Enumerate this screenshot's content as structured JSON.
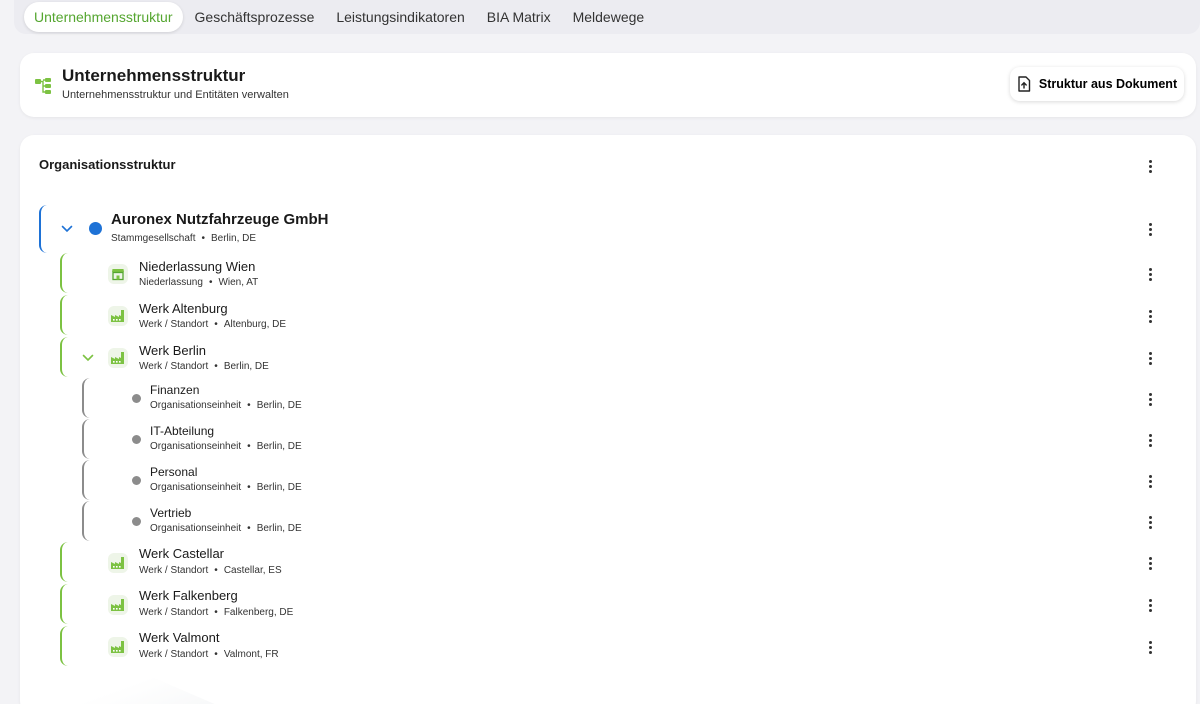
{
  "tabs": [
    {
      "label": "Unternehmensstruktur",
      "active": true
    },
    {
      "label": "Geschäftsprozesse",
      "active": false
    },
    {
      "label": "Leistungsindikatoren",
      "active": false
    },
    {
      "label": "BIA Matrix",
      "active": false
    },
    {
      "label": "Meldewege",
      "active": false
    }
  ],
  "header": {
    "icon": "hierarchy-icon",
    "title": "Unternehmensstruktur",
    "subtitle": "Unternehmensstruktur und Entitäten verwalten",
    "button_label": "Struktur aus Dokument",
    "button_icon": "file-upload-icon"
  },
  "section": {
    "title": "Organisationsstruktur"
  },
  "tree": {
    "root": {
      "name": "Auronex Nutzfahrzeuge GmbH",
      "type": "Stammgesellschaft",
      "location": "Berlin, DE",
      "expanded": true
    },
    "children": [
      {
        "name": "Niederlassung Wien",
        "type": "Niederlassung",
        "location": "Wien, AT",
        "icon": "storefront-icon",
        "expanded": false
      },
      {
        "name": "Werk Altenburg",
        "type": "Werk / Standort",
        "location": "Altenburg, DE",
        "icon": "factory-icon",
        "expanded": false
      },
      {
        "name": "Werk Berlin",
        "type": "Werk / Standort",
        "location": "Berlin, DE",
        "icon": "factory-icon",
        "expanded": true,
        "children": [
          {
            "name": "Finanzen",
            "type": "Organisationseinheit",
            "location": "Berlin, DE"
          },
          {
            "name": "IT-Abteilung",
            "type": "Organisationseinheit",
            "location": "Berlin, DE"
          },
          {
            "name": "Personal",
            "type": "Organisationseinheit",
            "location": "Berlin, DE"
          },
          {
            "name": "Vertrieb",
            "type": "Organisationseinheit",
            "location": "Berlin, DE"
          }
        ]
      },
      {
        "name": "Werk Castellar",
        "type": "Werk / Standort",
        "location": "Castellar, ES",
        "icon": "factory-icon",
        "expanded": false
      },
      {
        "name": "Werk Falkenberg",
        "type": "Werk / Standort",
        "location": "Falkenberg, DE",
        "icon": "factory-icon",
        "expanded": false
      },
      {
        "name": "Werk Valmont",
        "type": "Werk / Standort",
        "location": "Valmont, FR",
        "icon": "factory-icon",
        "expanded": false
      }
    ]
  },
  "meta_separator": "•",
  "colors": {
    "accent_green": "#7cc242",
    "tab_active_text": "#55a630",
    "root_blue": "#1e72d6",
    "sub_gray": "#8c8c8c"
  }
}
